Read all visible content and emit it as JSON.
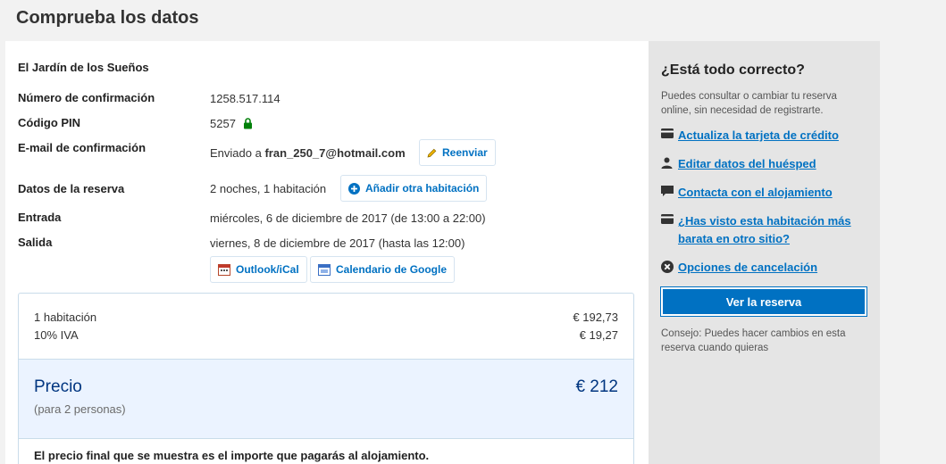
{
  "page": {
    "title": "Comprueba los datos"
  },
  "booking": {
    "hotel_name": "El Jardín de los Sueños",
    "confirmation_label": "Número de confirmación",
    "confirmation_value": "1258.517.114",
    "pin_label": "Código PIN",
    "pin_value": "5257",
    "email_label": "E-mail de confirmación",
    "email_prefix": "Enviado a",
    "email_value": "fran_250_7@hotmail.com",
    "resend_label": "Reenviar",
    "details_label": "Datos de la reserva",
    "details_value": "2 noches, 1 habitación",
    "add_room_label": "Añadir otra habitación",
    "checkin_label": "Entrada",
    "checkin_value": "miércoles, 6 de diciembre de 2017 (de 13:00 a 22:00)",
    "checkout_label": "Salida",
    "checkout_value": "viernes, 8 de diciembre de 2017 (hasta las 12:00)",
    "calendar_outlook": "Outlook/iCal",
    "calendar_google": "Calendario de Google"
  },
  "price": {
    "lines": [
      {
        "label": "1 habitación",
        "amount": "€ 192,73"
      },
      {
        "label": "10% IVA",
        "amount": "€ 19,27"
      }
    ],
    "total_label": "Precio",
    "total_amount": "€ 212",
    "total_sub": "(para 2 personas)",
    "note": "El precio final que se muestra es el importe que pagarás al alojamiento."
  },
  "sidebar": {
    "title": "¿Está todo correcto?",
    "description": "Puedes consultar o cambiar tu reserva online, sin necesidad de registrarte.",
    "links": [
      {
        "label": "Actualiza la tarjeta de crédito",
        "icon": "credit-card-icon"
      },
      {
        "label": "Editar datos del huésped",
        "icon": "person-icon"
      },
      {
        "label": "Contacta con el alojamiento",
        "icon": "chat-icon"
      },
      {
        "label": "¿Has visto esta habitación más barata en otro sitio?",
        "icon": "credit-card-icon"
      },
      {
        "label": "Opciones de cancelación",
        "icon": "cancel-icon"
      }
    ],
    "view_button": "Ver la reserva",
    "tip": "Consejo: Puedes hacer cambios en esta reserva cuando quieras"
  },
  "colors": {
    "accent": "#0071c2",
    "price_bg": "#ebf3ff",
    "lock": "#008009",
    "sidebar_bg": "#e5e5e5"
  }
}
